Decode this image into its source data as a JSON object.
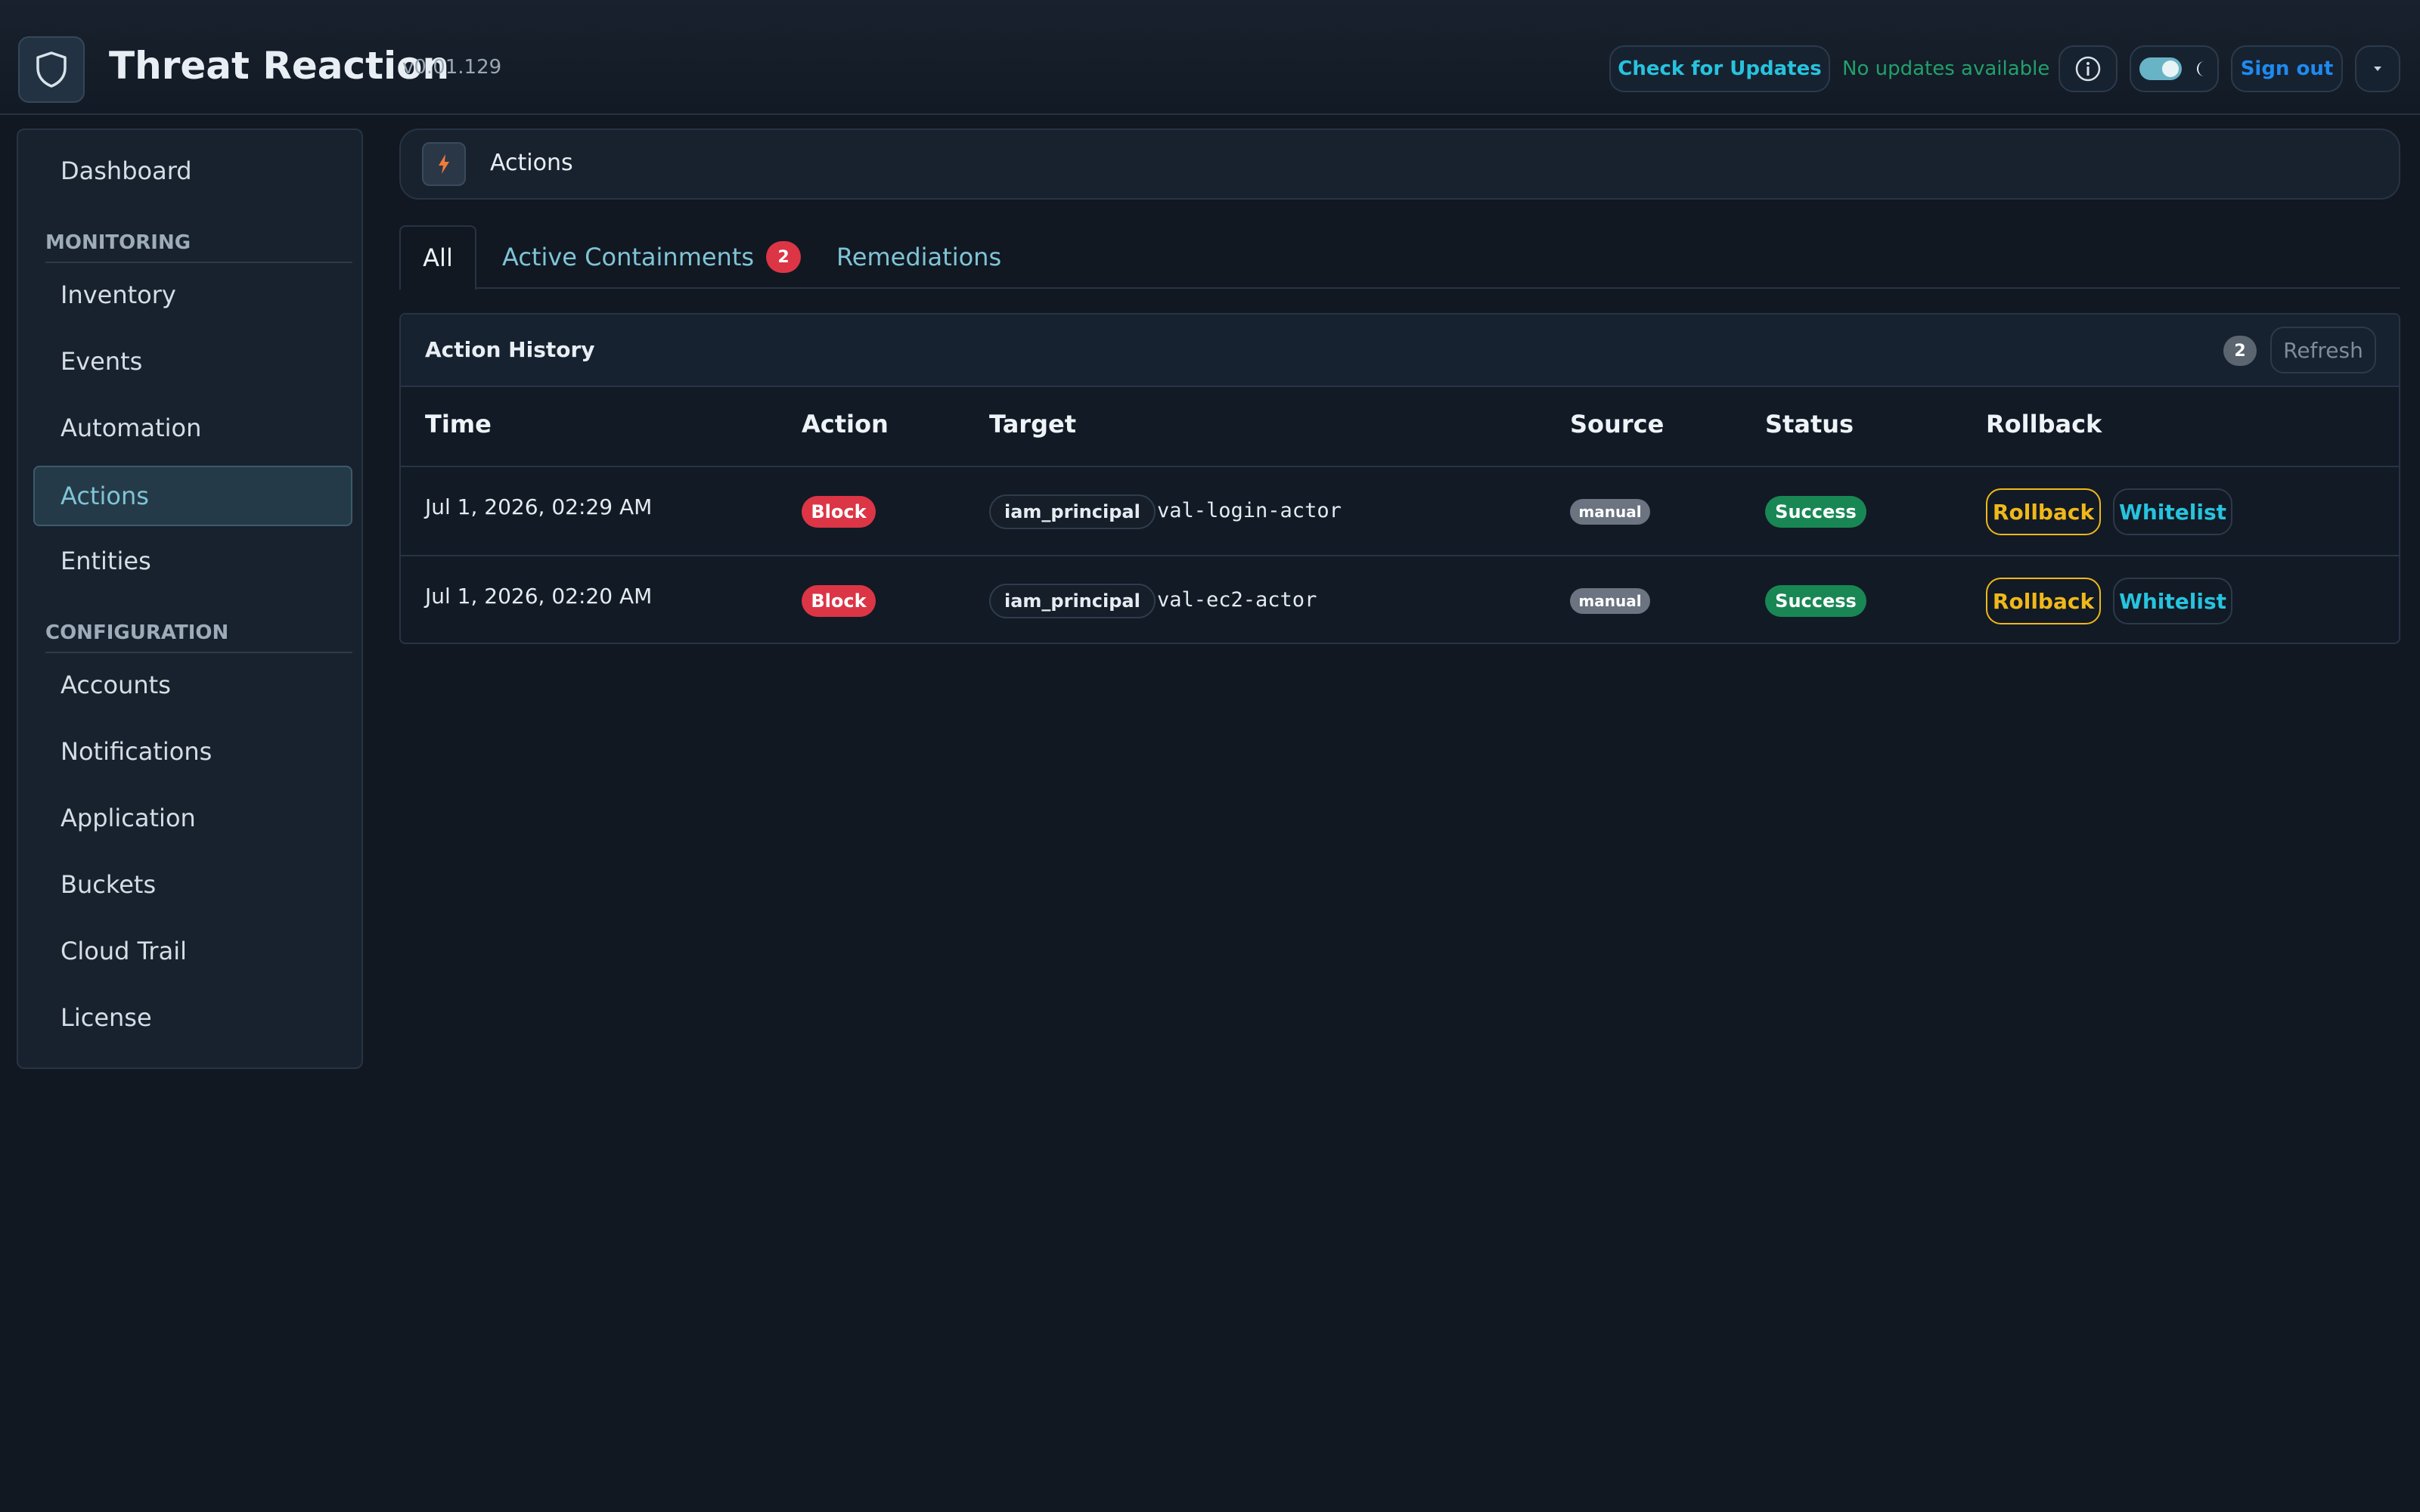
{
  "app": {
    "title": "Threat Reaction",
    "version": "v0.01.129"
  },
  "header": {
    "check_updates_label": "Check for Updates",
    "update_status": "No updates available",
    "info_icon": "info-icon",
    "theme_icon": "moon-icon",
    "sign_out_label": "Sign out",
    "menu_icon": "chevron-down-icon"
  },
  "sidebar": {
    "top_items": [
      {
        "label": "Dashboard"
      }
    ],
    "sections": [
      {
        "title": "MONITORING",
        "items": [
          {
            "label": "Inventory"
          },
          {
            "label": "Events"
          },
          {
            "label": "Automation"
          },
          {
            "label": "Actions",
            "active": true
          },
          {
            "label": "Entities"
          }
        ]
      },
      {
        "title": "CONFIGURATION",
        "items": [
          {
            "label": "Accounts"
          },
          {
            "label": "Notifications"
          },
          {
            "label": "Application"
          },
          {
            "label": "Buckets"
          },
          {
            "label": "Cloud Trail"
          },
          {
            "label": "License"
          }
        ]
      }
    ]
  },
  "page": {
    "title": "Actions",
    "icon": "lightning-icon"
  },
  "tabs": [
    {
      "label": "All",
      "active": true
    },
    {
      "label": "Active Containments",
      "badge": "2"
    },
    {
      "label": "Remediations"
    }
  ],
  "history": {
    "title": "Action History",
    "count": "2",
    "refresh_label": "Refresh",
    "columns": [
      "Time",
      "Action",
      "Target",
      "Source",
      "Status",
      "Rollback"
    ],
    "rows": [
      {
        "time": "Jul 1, 2026, 02:29 AM",
        "action": "Block",
        "target_type": "iam_principal",
        "target_name": "val-login-actor",
        "source": "manual",
        "status": "Success",
        "rollback_label": "Rollback",
        "whitelist_label": "Whitelist"
      },
      {
        "time": "Jul 1, 2026, 02:20 AM",
        "action": "Block",
        "target_type": "iam_principal",
        "target_name": "val-ec2-actor",
        "source": "manual",
        "status": "Success",
        "rollback_label": "Rollback",
        "whitelist_label": "Whitelist"
      }
    ]
  },
  "colors": {
    "accent": "#27c3de",
    "danger": "#dc3545",
    "success": "#198754",
    "warning": "#f0b81a"
  }
}
